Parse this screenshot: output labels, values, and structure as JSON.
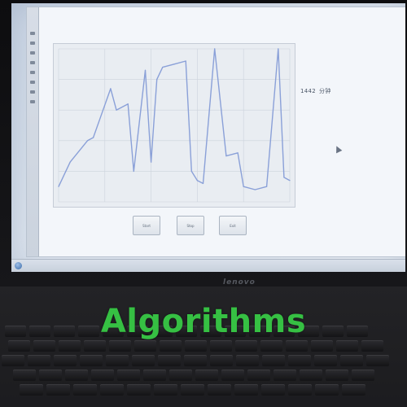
{
  "caption": "Algorithms",
  "screen": {
    "counter_value": "1442",
    "counter_unit": "分钟"
  },
  "buttons": [
    {
      "label": "Start"
    },
    {
      "label": "Stop"
    },
    {
      "label": "Exit"
    }
  ],
  "laptop_brand": "lenovo",
  "colors": {
    "caption": "#36c043",
    "plot_line": "#8aa0d8",
    "screen_bg": "#e8edf3"
  },
  "chart_data": {
    "type": "line",
    "x": [
      0,
      2,
      5,
      6,
      9,
      10,
      12,
      13,
      15,
      16,
      17,
      18,
      20,
      22,
      23,
      24,
      25,
      27,
      29,
      31,
      32,
      34,
      36,
      38,
      39,
      40
    ],
    "values": [
      50,
      58,
      65,
      66,
      82,
      75,
      77,
      55,
      88,
      58,
      85,
      89,
      90,
      91,
      55,
      52,
      51,
      95,
      60,
      61,
      50,
      49,
      50,
      95,
      53,
      52
    ],
    "xlim": [
      0,
      40
    ],
    "ylim": [
      45,
      95
    ],
    "grid": true
  }
}
